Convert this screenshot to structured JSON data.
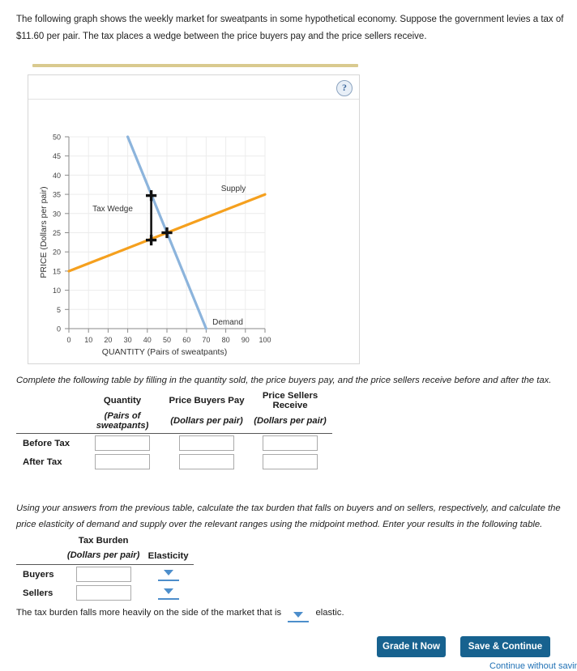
{
  "intro": {
    "paragraph": "The following graph shows the weekly market for sweatpants in some hypothetical economy. Suppose the government levies a tax of $11.60 per pair. The tax places a wedge between the price buyers pay and the price sellers receive."
  },
  "graph_panel": {
    "help_icon_label": "?"
  },
  "chart_data": {
    "type": "line",
    "title": "",
    "xlabel": "QUANTITY (Pairs of sweatpants)",
    "ylabel": "PRICE (Dollars per pair)",
    "xlim": [
      0,
      100
    ],
    "ylim": [
      0,
      50
    ],
    "xticks": [
      0,
      10,
      20,
      30,
      40,
      50,
      60,
      70,
      80,
      90,
      100
    ],
    "yticks": [
      0,
      5,
      10,
      15,
      20,
      25,
      30,
      35,
      40,
      45,
      50
    ],
    "grid": true,
    "legend_position": "inline-labels",
    "series": [
      {
        "name": "Supply",
        "color": "#f5a01e",
        "label": "Supply",
        "label_at": {
          "x": 84,
          "y": 36.5
        },
        "points": [
          {
            "x": 0,
            "y": 15
          },
          {
            "x": 100,
            "y": 35
          }
        ]
      },
      {
        "name": "Demand",
        "color": "#8cb4dc",
        "label": "Demand",
        "label_at": {
          "x": 72,
          "y": 2.0
        },
        "points": [
          {
            "x": 30,
            "y": 50
          },
          {
            "x": 70,
            "y": 0
          }
        ]
      }
    ],
    "annotations": [
      {
        "name": "tax-wedge",
        "label": "Tax Wedge",
        "label_at": {
          "x": 22,
          "y": 28.5
        },
        "color": "#000000",
        "segment": {
          "x": 42,
          "y_top": 35,
          "y_bottom": 23.4
        },
        "markers": [
          {
            "x": 42,
            "y": 35
          },
          {
            "x": 42,
            "y": 23.4
          }
        ]
      },
      {
        "name": "equilibrium-marker",
        "markers": [
          {
            "x": 50,
            "y": 25
          }
        ],
        "color": "#000000"
      }
    ]
  },
  "instructions": {
    "table1": "Complete the following table by filling in the quantity sold, the price buyers pay, and the price sellers receive before and after the tax.",
    "table2": "Using your answers from the previous table, calculate the tax burden that falls on buyers and on sellers, respectively, and calculate the price elasticity of demand and supply over the relevant ranges using the midpoint method. Enter your results in the following table."
  },
  "table1": {
    "headers_main": [
      "",
      "Quantity",
      "Price Buyers Pay",
      "Price Sellers Receive"
    ],
    "headers_sub": [
      "",
      "(Pairs of sweatpants)",
      "(Dollars per pair)",
      "(Dollars per pair)"
    ],
    "rows": [
      {
        "label": "Before Tax",
        "quantity": "",
        "price_buyers_pay": "",
        "price_sellers_receive": ""
      },
      {
        "label": "After Tax",
        "quantity": "",
        "price_buyers_pay": "",
        "price_sellers_receive": ""
      }
    ]
  },
  "table2": {
    "headers_main": [
      "",
      "Tax Burden",
      "Elasticity"
    ],
    "headers_sub": [
      "",
      "(Dollars per pair)",
      ""
    ],
    "rows": [
      {
        "label": "Buyers",
        "tax_burden": "",
        "elasticity": ""
      },
      {
        "label": "Sellers",
        "tax_burden": "",
        "elasticity": ""
      }
    ]
  },
  "conclusion": {
    "text_before": "The tax burden falls more heavily on the side of the market that is",
    "text_after": "elastic.",
    "dropdown_value": ""
  },
  "footer": {
    "grade_button": "Grade It Now",
    "save_button": "Save & Continue",
    "continue_link": "Continue without saving"
  },
  "colors": {
    "supply": "#f5a01e",
    "demand": "#8cb4dc",
    "button": "#17628f",
    "link": "#2071b5",
    "divider": "#d9ca8f"
  }
}
